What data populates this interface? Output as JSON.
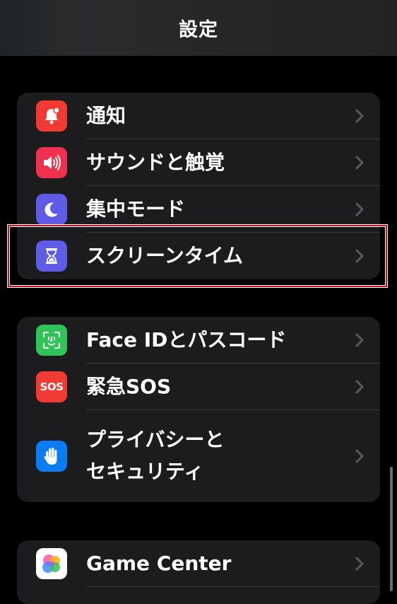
{
  "header": {
    "title": "設定"
  },
  "groups": [
    {
      "items": [
        {
          "label": "通知",
          "icon": "bell-icon",
          "icon_color": "#f03a33"
        },
        {
          "label": "サウンドと触覚",
          "icon": "speaker-icon",
          "icon_color": "#f0304f"
        },
        {
          "label": "集中モード",
          "icon": "moon-icon",
          "icon_color": "#5e5ce6"
        },
        {
          "label": "スクリーンタイム",
          "icon": "hourglass-icon",
          "icon_color": "#5e5ce6",
          "highlighted": true
        }
      ]
    },
    {
      "items": [
        {
          "label": "Face IDとパスコード",
          "icon": "face-id-icon",
          "icon_color": "#32c25a"
        },
        {
          "label": "緊急SOS",
          "icon": "sos-icon",
          "icon_color": "#f03a33",
          "icon_text": "SOS"
        },
        {
          "label_line1": "プライバシーと",
          "label_line2": "セキュリティ",
          "icon": "hand-icon",
          "icon_color": "#0a7df4"
        }
      ]
    },
    {
      "items": [
        {
          "label": "Game Center",
          "icon": "game-center-icon",
          "icon_color": "#ffffff"
        }
      ]
    }
  ],
  "colors": {
    "background": "#000000",
    "group_background": "#1c1c1e",
    "separator": "#38383a",
    "chevron": "#5a5a5e",
    "highlight_border": "#c8101a"
  }
}
